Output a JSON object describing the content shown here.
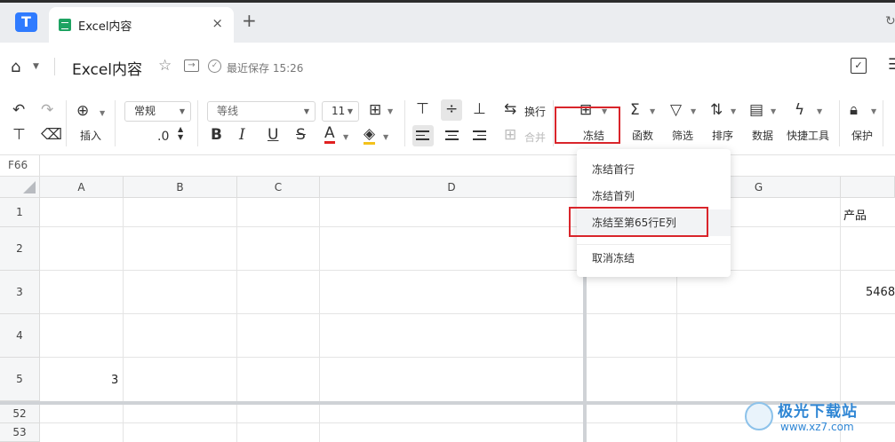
{
  "browser": {
    "app_logo": "T",
    "tab_title": "Excel内容",
    "tab_close": "×",
    "new_tab": "+",
    "refresh": "↻"
  },
  "header": {
    "home_icon": "⌂",
    "title": "Excel内容",
    "saved_status": "最近保存 15:26"
  },
  "toolbar": {
    "undo": "↶",
    "redo": "↷",
    "insert_label": "插入",
    "format_value": "常规",
    "decimal_label": ".0",
    "font_value": "等线",
    "font_size": "11",
    "bold": "B",
    "italic": "I",
    "underline": "U",
    "strike": "S",
    "font_color": "A",
    "wrap_label": "换行",
    "merge_label": "合并",
    "freeze_label": "冻结",
    "function_label": "函数",
    "filter_label": "筛选",
    "sort_label": "排序",
    "data_label": "数据",
    "quick_tools_label": "快捷工具",
    "protect_label": "保护",
    "sigma": "Σ"
  },
  "sheet": {
    "name_box": "F66",
    "columns": [
      "A",
      "B",
      "C",
      "D",
      "G"
    ],
    "rows": [
      "1",
      "2",
      "3",
      "4",
      "5",
      "52",
      "53"
    ],
    "cells": {
      "a5": "3",
      "h1": "产品",
      "h3": "5468"
    }
  },
  "freeze_menu": {
    "items": [
      "冻结首行",
      "冻结首列",
      "冻结至第65行E列",
      "取消冻结"
    ]
  },
  "watermark": {
    "name": "极光下载站",
    "url": "www.xz7.com"
  },
  "colors": {
    "accent": "#2f7bff",
    "highlight_border": "#d9252b",
    "sheet_icon": "#1ea362"
  }
}
